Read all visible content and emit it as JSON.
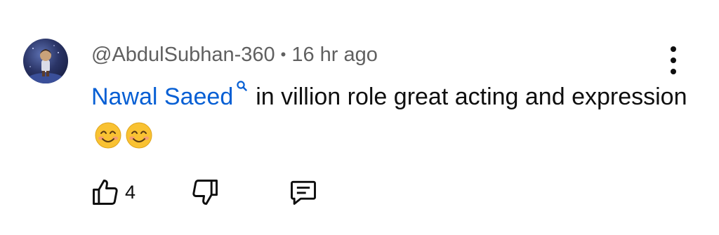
{
  "comment": {
    "author": "@AbdulSubhan-360",
    "separator": "•",
    "time": "16 hr ago",
    "mention": "Nawal Saeed",
    "text_line": "in villion role great acting and expression",
    "emojis": [
      "smiling-face-emoji",
      "smiling-face-emoji"
    ],
    "like_count": "4"
  },
  "icons": {
    "mention": "search-icon",
    "more": "more-vertical-icon",
    "like": "thumbs-up-icon",
    "dislike": "thumbs-down-icon",
    "reply": "reply-comment-icon"
  },
  "colors": {
    "mention": "#065fd4",
    "meta": "#606060",
    "text": "#0f0f0f",
    "emoji": "#f9c232"
  }
}
